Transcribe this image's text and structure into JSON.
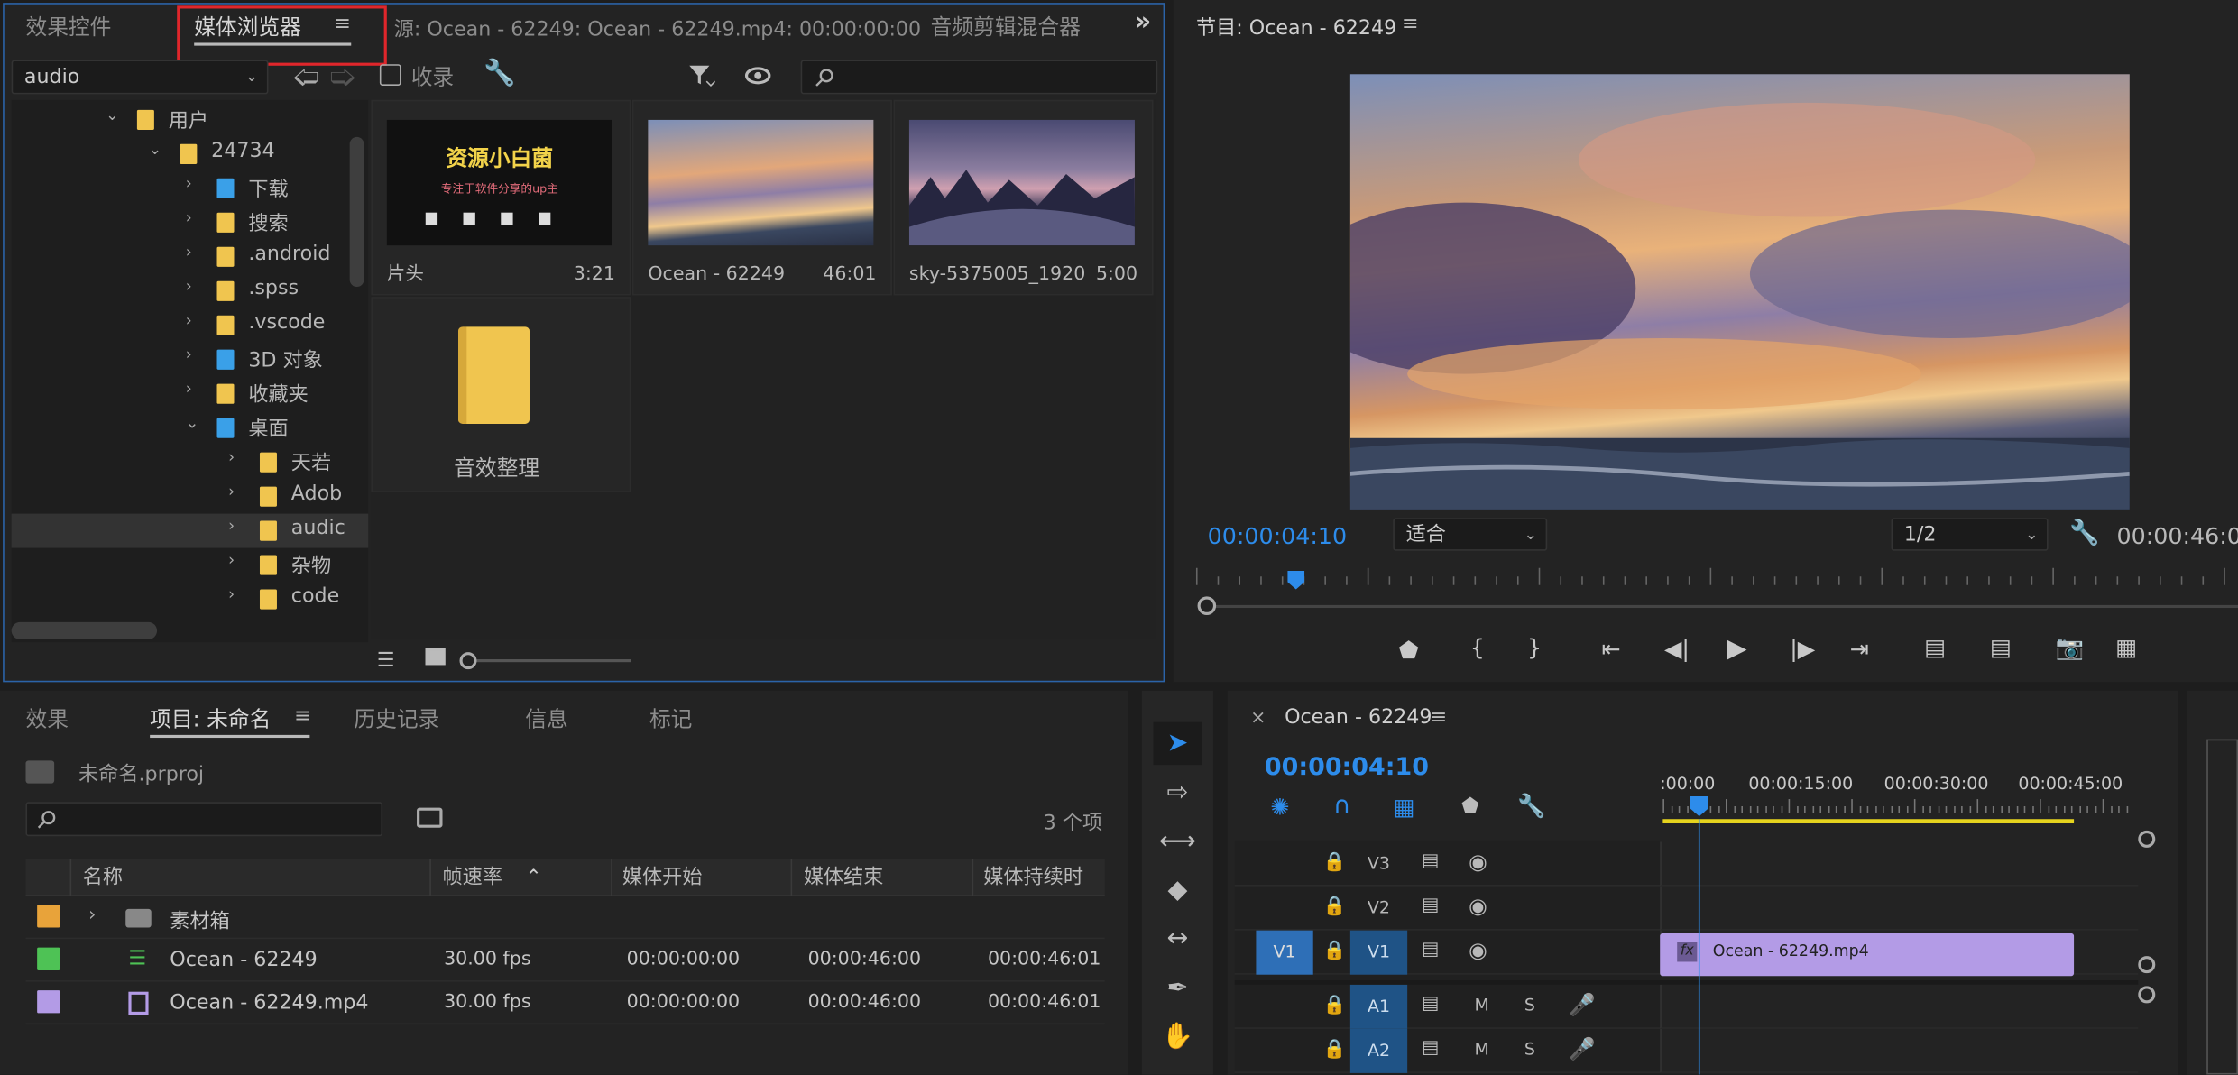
{
  "source_panel": {
    "tabs": [
      "效果控件",
      "媒体浏览器",
      "源: Ocean - 62249: Ocean - 62249.mp4: 00:00:00:00",
      "音频剪辑混合器"
    ],
    "more_icon": "double-chevron-right-icon",
    "menu_icon": "≡",
    "dropdown_value": "audio",
    "ingest_label": "收录",
    "search_placeholder": "",
    "tree": [
      {
        "label": "用户",
        "level": 1,
        "expanded": true,
        "icon": "folder-icon"
      },
      {
        "label": "24734",
        "level": 2,
        "expanded": true,
        "icon": "user-folder-icon"
      },
      {
        "label": "下载",
        "level": 3,
        "expanded": false,
        "icon": "download-icon"
      },
      {
        "label": "搜索",
        "level": 3,
        "expanded": false,
        "icon": "search-folder-icon"
      },
      {
        "label": ".android",
        "level": 3,
        "expanded": false,
        "icon": "folder-icon"
      },
      {
        "label": ".spss",
        "level": 3,
        "expanded": false,
        "icon": "folder-icon"
      },
      {
        "label": ".vscode",
        "level": 3,
        "expanded": false,
        "icon": "folder-icon"
      },
      {
        "label": "3D 对象",
        "level": 3,
        "expanded": false,
        "icon": "3d-object-icon"
      },
      {
        "label": "收藏夹",
        "level": 3,
        "expanded": false,
        "icon": "favorites-folder-icon"
      },
      {
        "label": "桌面",
        "level": 3,
        "expanded": true,
        "icon": "desktop-folder-icon"
      },
      {
        "label": "天若",
        "level": 4,
        "expanded": false,
        "icon": "folder-icon"
      },
      {
        "label": "Adob",
        "level": 4,
        "expanded": false,
        "icon": "folder-icon"
      },
      {
        "label": "audic",
        "level": 4,
        "expanded": false,
        "icon": "folder-icon",
        "selected": true
      },
      {
        "label": "杂物",
        "level": 4,
        "expanded": false,
        "icon": "folder-icon"
      },
      {
        "label": "code",
        "level": 4,
        "expanded": false,
        "icon": "folder-icon"
      }
    ],
    "thumbs": [
      {
        "label": "片头",
        "duration": "3:21",
        "kind": "promo",
        "promo_title": "资源小白菌",
        "promo_sub": "专注于软件分享的up主"
      },
      {
        "label": "Ocean - 62249",
        "duration": "46:01",
        "kind": "ocean"
      },
      {
        "label": "sky-5375005_1920",
        "duration": "5:00",
        "kind": "sky"
      },
      {
        "label": "音效整理",
        "duration": "",
        "kind": "folder"
      }
    ]
  },
  "program_panel": {
    "title": "节目: Ocean - 62249",
    "timecode": "00:00:04:10",
    "fit_value": "适合",
    "resolution_value": "1/2",
    "duration_timecode": "00:00:46:0"
  },
  "project_panel": {
    "tabs": [
      "效果",
      "项目: 未命名",
      "历史记录",
      "信息",
      "标记"
    ],
    "project_file": "未命名.prproj",
    "item_count": "3 个项",
    "columns": [
      "名称",
      "帧速率",
      "媒体开始",
      "媒体结束",
      "媒体持续时"
    ],
    "rows": [
      {
        "color": "#e8a33a",
        "name": "素材箱",
        "fps": "",
        "start": "",
        "end": "",
        "dur": "",
        "type": "bin"
      },
      {
        "color": "#4ec255",
        "name": "Ocean - 62249",
        "fps": "30.00 fps",
        "start": "00:00:00:00",
        "end": "00:00:46:00",
        "dur": "00:00:46:01",
        "type": "sequence"
      },
      {
        "color": "#b39be6",
        "name": "Ocean - 62249.mp4",
        "fps": "30.00 fps",
        "start": "00:00:00:00",
        "end": "00:00:46:00",
        "dur": "00:00:46:01",
        "type": "clip"
      }
    ]
  },
  "timeline": {
    "title": "Ocean - 62249",
    "timecode": "00:00:04:10",
    "ruler": [
      ":00:00",
      "00:00:15:00",
      "00:00:30:00",
      "00:00:45:00"
    ],
    "tracks": [
      {
        "name": "V3",
        "source": ""
      },
      {
        "name": "V2",
        "source": ""
      },
      {
        "name": "V1",
        "source": "V1"
      },
      {
        "name": "A1",
        "source": ""
      },
      {
        "name": "A2",
        "source": ""
      }
    ],
    "clip_label": "Ocean - 62249.mp4",
    "fx_label": "fx",
    "mute_label": "M",
    "solo_label": "S"
  },
  "colors": {
    "accent": "#2d8ceb",
    "highlight": "#e0262b",
    "clip": "#b39be6",
    "yellow": "#e6d41e"
  }
}
